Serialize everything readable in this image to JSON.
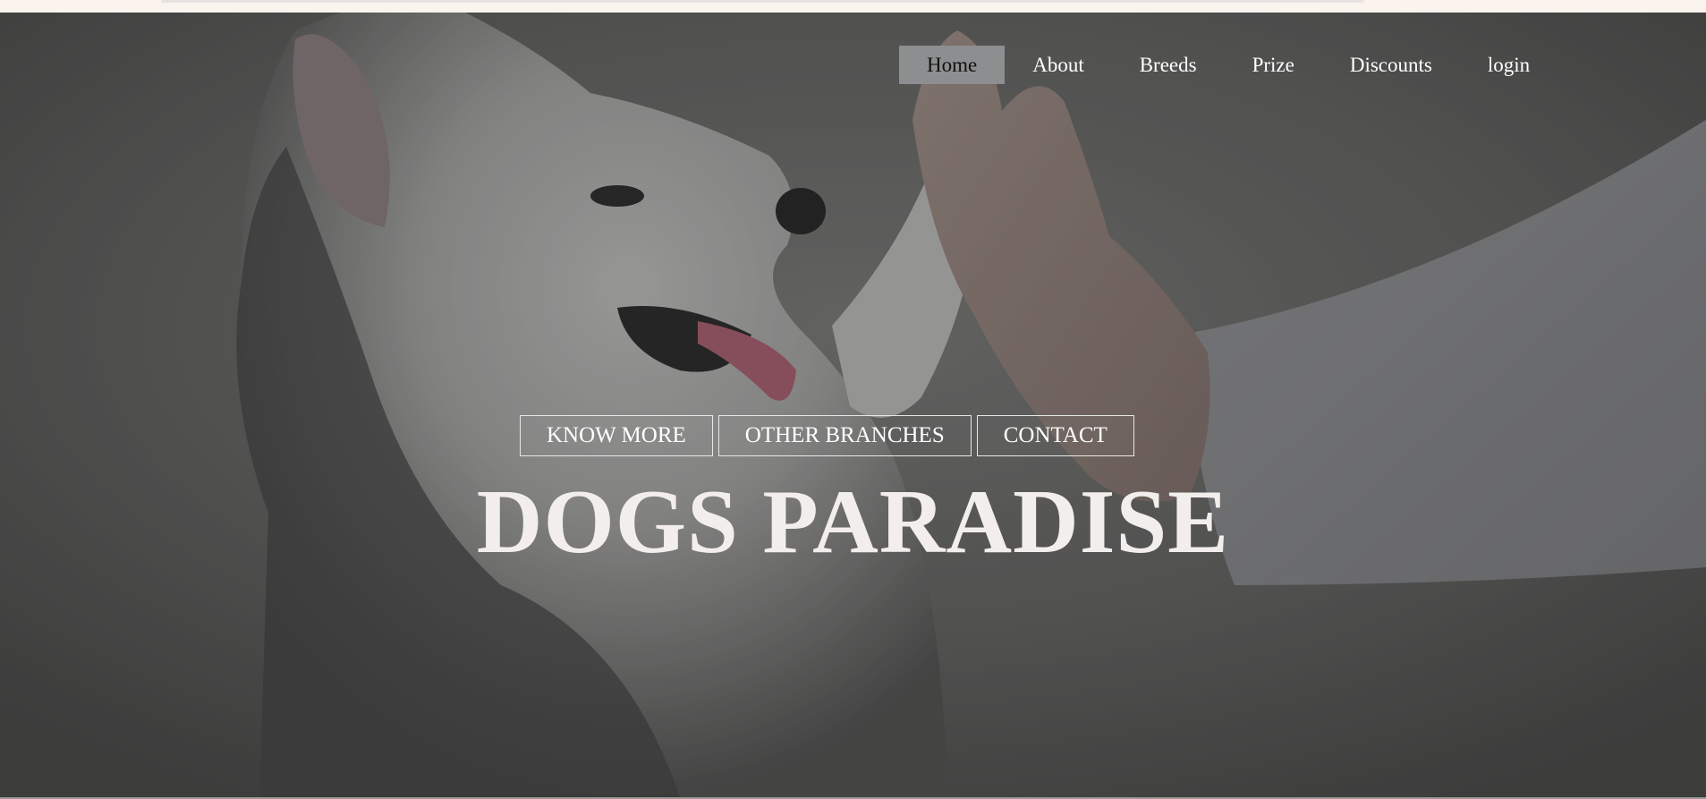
{
  "nav": {
    "items": [
      {
        "label": "Home",
        "active": true
      },
      {
        "label": "About"
      },
      {
        "label": "Breeds"
      },
      {
        "label": "Prize"
      },
      {
        "label": "Discounts"
      },
      {
        "label": "login"
      }
    ]
  },
  "hero": {
    "image": "husky-puppy-high-five-photo",
    "buttons": [
      {
        "label": "KNOW MORE"
      },
      {
        "label": "OTHER BRANCHES"
      },
      {
        "label": "CONTACT"
      }
    ],
    "title": "DOGS PARADISE"
  },
  "colors": {
    "title": "#f2eeec",
    "nav_text": "#ffffff",
    "nav_active_bg": "#8d8e90",
    "nav_active_text": "#111111",
    "button_border": "#e8e8e8"
  }
}
